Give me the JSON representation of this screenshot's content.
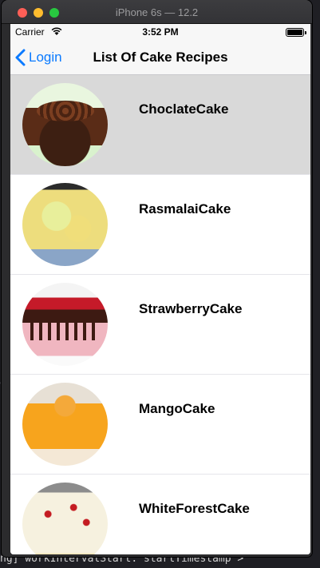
{
  "window": {
    "title": "iPhone 6s — 12.2"
  },
  "ide": {
    "bottom_line": "ng] workIntervalStart: startTimestamp >"
  },
  "statusbar": {
    "carrier": "Carrier",
    "time": "3:52 PM"
  },
  "navbar": {
    "back_label": "Login",
    "title": "List Of Cake Recipes"
  },
  "cakes": [
    {
      "name": "ChoclateCake",
      "selected": true
    },
    {
      "name": "RasmalaiCake",
      "selected": false
    },
    {
      "name": "StrawberryCake",
      "selected": false
    },
    {
      "name": "MangoCake",
      "selected": false
    },
    {
      "name": "WhiteForestCake",
      "selected": false
    }
  ],
  "colors": {
    "accent": "#0a7aff",
    "selected_row": "#d9d9d9"
  }
}
